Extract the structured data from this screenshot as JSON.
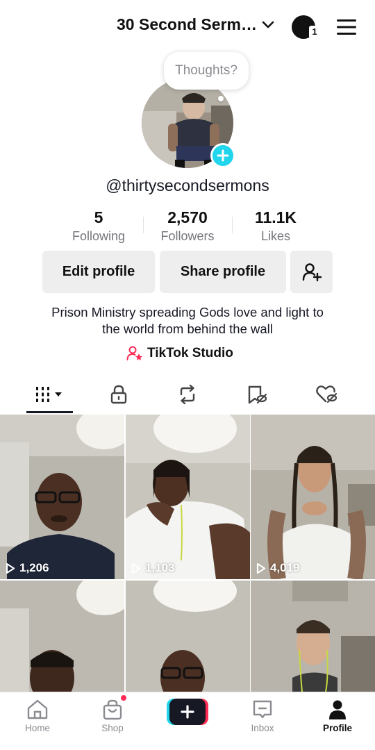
{
  "header": {
    "account_name": "30 Second Serm…",
    "notification_count": "1"
  },
  "profile": {
    "bubble_text": "Thoughts?",
    "username": "@thirtysecondsermons",
    "stats": [
      {
        "value": "5",
        "label": "Following"
      },
      {
        "value": "2,570",
        "label": "Followers"
      },
      {
        "value": "11.1K",
        "label": "Likes"
      }
    ],
    "edit_label": "Edit profile",
    "share_label": "Share profile",
    "bio_line1": "Prison Ministry spreading Gods love and light to",
    "bio_line2": "the world from behind the wall",
    "studio_label": "TikTok Studio"
  },
  "tabs": [
    "videos-grid-icon",
    "lock-icon",
    "repost-icon",
    "tagged-icon",
    "liked-icon"
  ],
  "videos": [
    {
      "views": "1,206"
    },
    {
      "views": "1,103"
    },
    {
      "views": "4,019"
    },
    {
      "views": ""
    },
    {
      "views": ""
    },
    {
      "views": ""
    }
  ],
  "nav": {
    "home": "Home",
    "shop": "Shop",
    "inbox": "Inbox",
    "profile": "Profile"
  },
  "colors": {
    "accent_cyan": "#20d5ec",
    "accent_red": "#fe2c55"
  }
}
